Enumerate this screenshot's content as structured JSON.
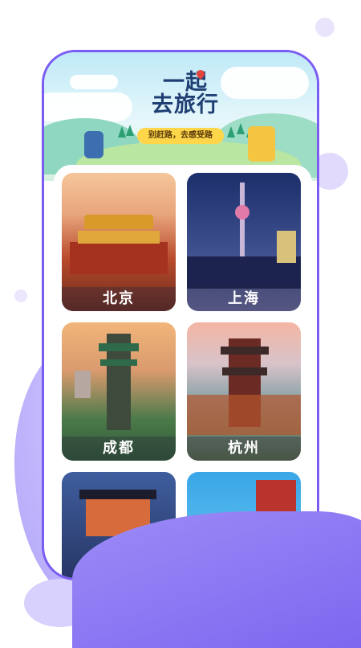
{
  "banner": {
    "title_line1": "一起",
    "title_line2": "去旅行",
    "tagline": "别赶路，去感受路"
  },
  "cities": [
    {
      "name": "北京"
    },
    {
      "name": "上海"
    },
    {
      "name": "成都"
    },
    {
      "name": "杭州"
    },
    {
      "name": ""
    },
    {
      "name": ""
    }
  ],
  "colors": {
    "frame": "#7b5cf2",
    "accent": "#9d8cf7",
    "banner_title": "#1f3f73",
    "tag_bg": "#ffd54a"
  }
}
